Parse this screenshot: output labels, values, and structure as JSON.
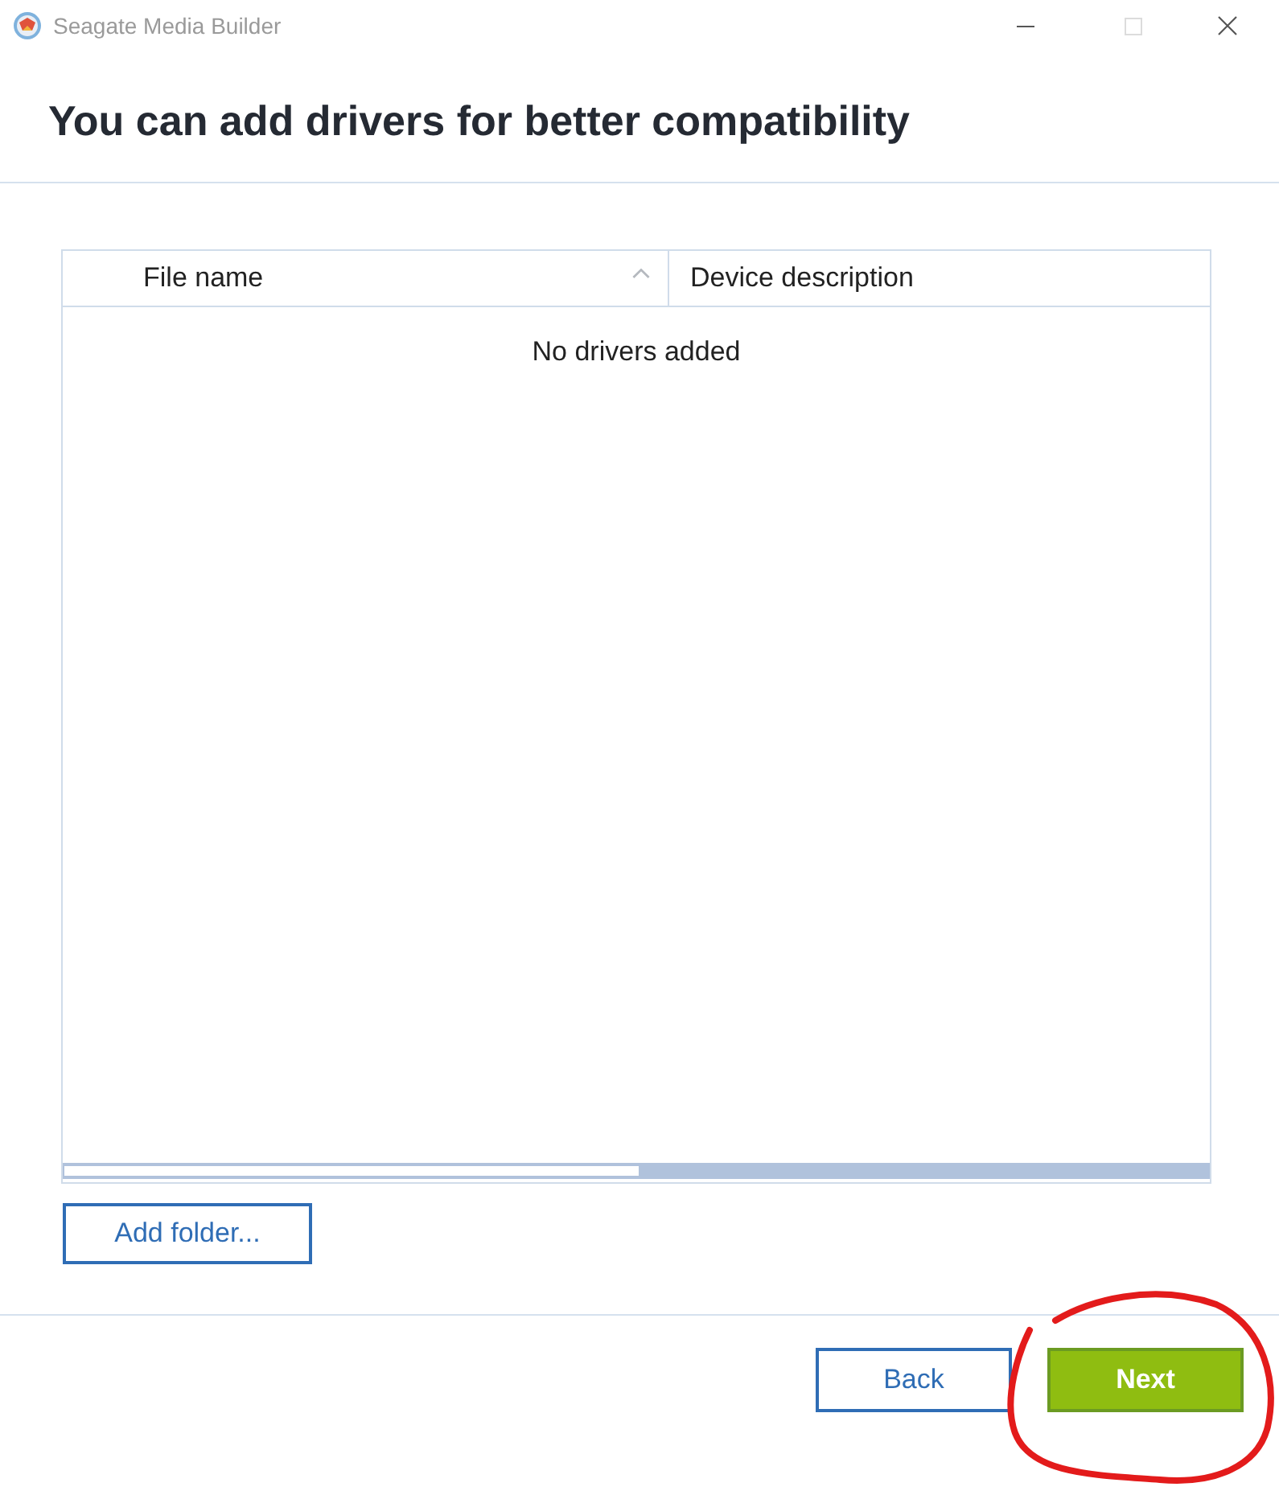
{
  "window": {
    "title": "Seagate Media Builder",
    "controls": [
      {
        "kind": "minimize",
        "disabled": false
      },
      {
        "kind": "maximize",
        "disabled": true
      },
      {
        "kind": "close",
        "disabled": false
      }
    ]
  },
  "heading": "You can add drivers for better compatibility",
  "table": {
    "columns": [
      {
        "label": "File name",
        "sorted": true
      },
      {
        "label": "Device description",
        "sorted": false
      }
    ],
    "empty_message": "No drivers added"
  },
  "add_button": "Add folder...",
  "footer_buttons": [
    {
      "label": "Back",
      "kind": "secondary"
    },
    {
      "label": "Next",
      "kind": "primary"
    }
  ],
  "annotation": {
    "kind": "circle",
    "color": "#e31b1b"
  }
}
